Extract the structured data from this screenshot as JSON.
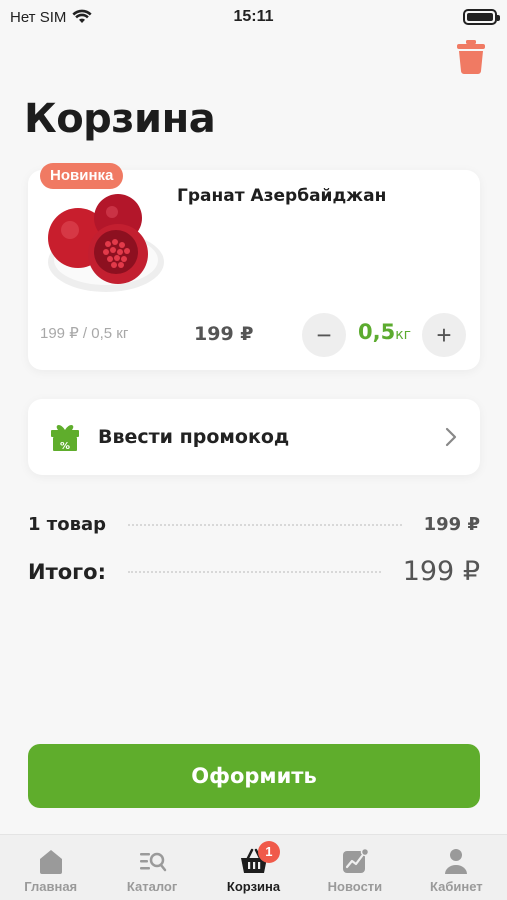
{
  "status_bar": {
    "carrier": "Нет SIM",
    "time": "15:11"
  },
  "page": {
    "title": "Корзина"
  },
  "cart_item": {
    "badge": "Новинка",
    "name": "Гранат Азербайджан",
    "unit_price": "199 ₽ / 0,5 кг",
    "line_price": "199 ₽",
    "quantity": "0,5",
    "quantity_unit": "кг",
    "minus_symbol": "−",
    "plus_symbol": "+"
  },
  "promo": {
    "label": "Ввести промокод",
    "icon": "gift-percent-icon"
  },
  "summary": {
    "count_label": "1 товар",
    "count_value": "199 ₽",
    "total_label": "Итого:",
    "total_value": "199 ₽"
  },
  "checkout": {
    "label": "Оформить"
  },
  "tabbar": {
    "tabs": [
      {
        "label": "Главная",
        "icon": "home-icon"
      },
      {
        "label": "Каталог",
        "icon": "catalog-search-icon"
      },
      {
        "label": "Корзина",
        "icon": "basket-icon",
        "badge": "1",
        "active": true
      },
      {
        "label": "Новости",
        "icon": "news-chart-icon"
      },
      {
        "label": "Кабинет",
        "icon": "profile-icon"
      }
    ]
  },
  "colors": {
    "accent_green": "#5fad2c",
    "badge_red": "#f07a63",
    "trash_red": "#f07a63"
  }
}
